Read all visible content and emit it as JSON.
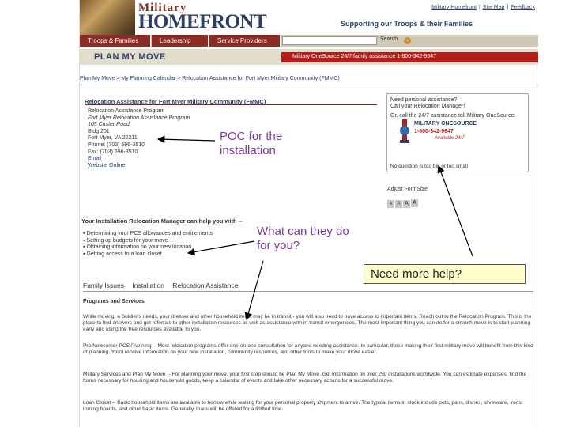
{
  "header": {
    "logo_top": "Military",
    "logo_main": "HOMEFRONT",
    "tagline": "Supporting our Troops & their Families",
    "toplinks": [
      "Military Homefront",
      "Site Map",
      "Feedback"
    ]
  },
  "nav": {
    "tabs": [
      "Troops & Families",
      "Leadership",
      "Service Providers"
    ],
    "search_label": "Search"
  },
  "banner": {
    "title": "PLAN MY MOVE",
    "red_text": "Military OneSource 24/7 family assistance 1-800-342-9647"
  },
  "breadcrumb": {
    "items": [
      "Plan My Move",
      "My Planning Calendar",
      "Relocation Assistance for Fort Myer Military Community (FMMC)"
    ]
  },
  "poc": {
    "title": "Relocation Assistance for Fort Myer Military Community (FMMC)",
    "lines": [
      "Relocation Assistance Program",
      "Fort Myer Relocation Assistance Program",
      "105 Custer Road",
      "Bldg 201",
      "Fort Myer, VA 22211",
      "Phone: (703) 696-3510",
      "Fax: (703) 696-3510"
    ],
    "email": "Email",
    "website": "Website Online"
  },
  "help": {
    "line1": "Need personal assistance?",
    "line2": "Call your Relocation Manager!",
    "line3": "Or, call the 24/7 assistance toll Military OneSource:",
    "brand": "MILITARY ONESOURCE",
    "phone": "1-800-342-9647",
    "avail": "Available 24/7",
    "questions": "No question is too big or too small",
    "font_label": "Adjust Font Size",
    "font_buttons": [
      "A",
      "A",
      "A",
      "A"
    ]
  },
  "manager": {
    "title": "Your Installation Relocation Manager can help you with --",
    "items": [
      "Determining your PCS allowances and entitlements",
      "Setting up budgets for your move",
      "Obtaining information on your new location",
      "Getting access to a loan closet"
    ]
  },
  "tabs": [
    "Family Issues",
    "Installation",
    "Relocation Assistance"
  ],
  "programs": {
    "title": "Programs and Services",
    "paragraphs": [
      "While moving, a Soldier's needs, your dresser and other household items may be in transit - you will also need to have access to important items. Reach out to the Relocation Program. This is the place to find answers and get referrals to other installation resources as well as assistance with in-transit emergencies. The most important thing you can do for a smooth move is to start planning early and using the free resources available to you.",
      "Pre/Newcomer PCS Planning -- Most relocation programs offer one-on-one consultation for anyone needing assistance. In particular, those making their first military move will benefit from this kind of planning. You'll receive information on your new installation, community resources, and other tools to make your move easier.",
      "Military Services and Plan My Move -- For planning your move, your first stop should be Plan My Move. Get information on over 250 installations worldwide. You can estimate expenses, find the forms necessary for housing and household goods, keep a calendar of events and take other necessary actions for a successful move.",
      "Loan Closet -- Basic household items are available to borrow while waiting for your personal property shipment to arrive. The typical items in stock include pots, pans, dishes, silverware, irons, ironing boards, and other basic items. Generally, loans will be offered for a limited time."
    ]
  },
  "annotations": {
    "poc": [
      "POC for the",
      "installation"
    ],
    "what": [
      "What can they do",
      "for you?"
    ],
    "need_help": "Need more help?"
  }
}
